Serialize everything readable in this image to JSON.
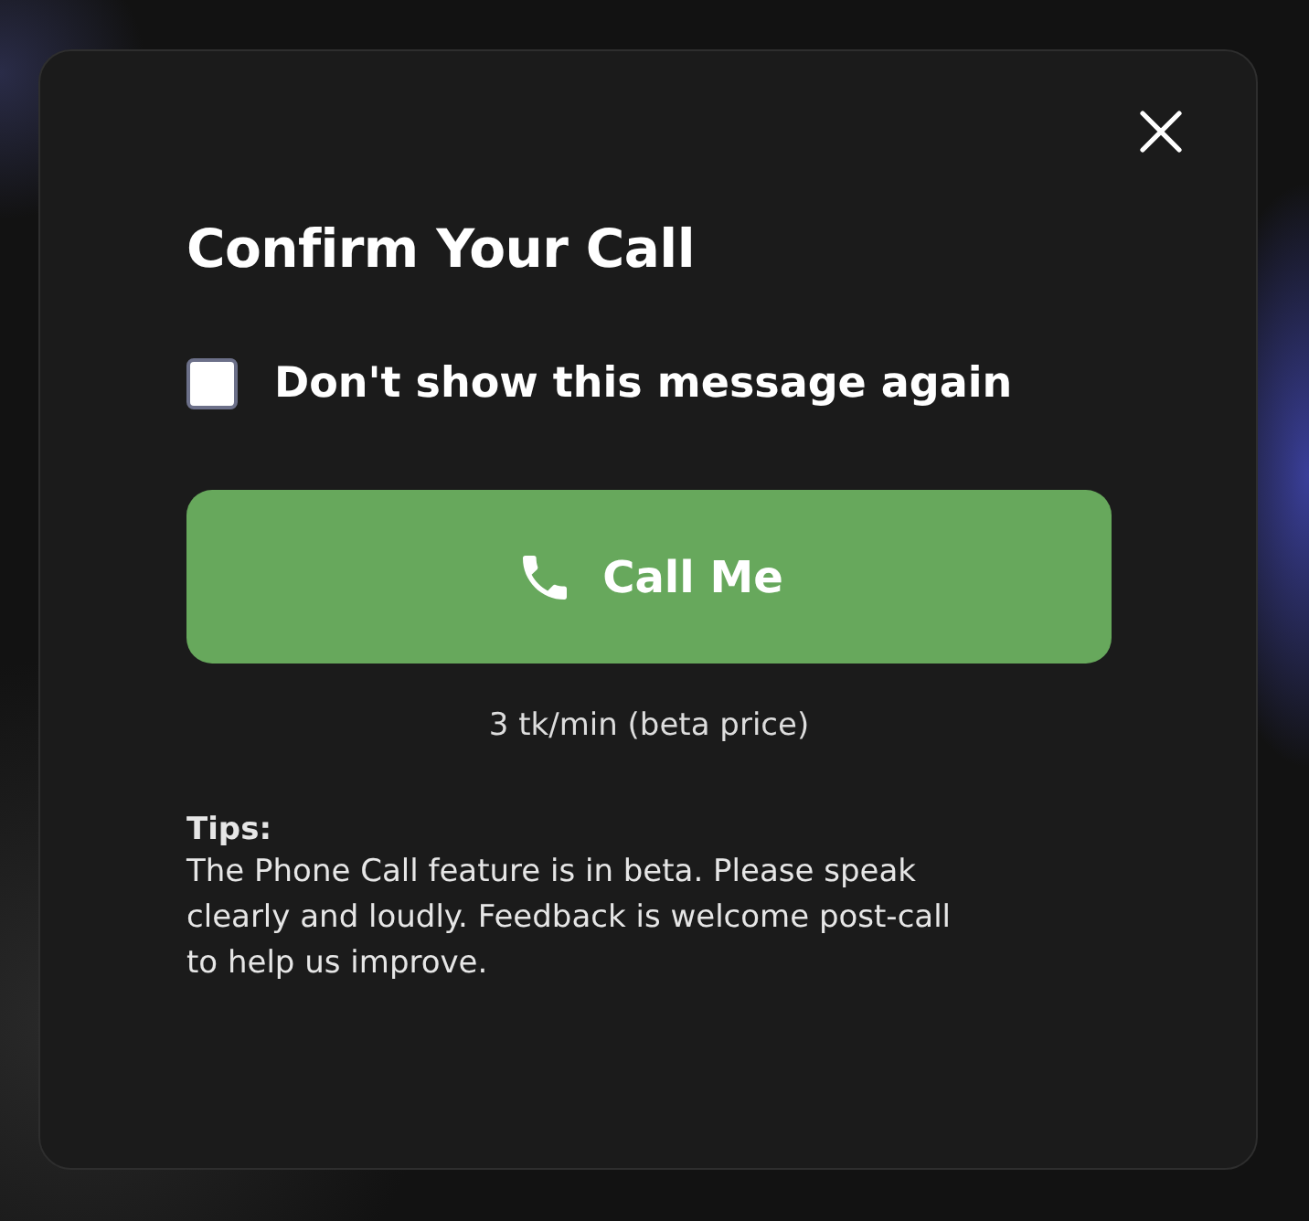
{
  "dialog": {
    "title": "Confirm Your Call",
    "checkbox": {
      "label": "Don't show this message again",
      "checked": false
    },
    "call_button": {
      "label": "Call Me"
    },
    "price": "3 tk/min (beta price)",
    "tips": {
      "heading": "Tips:",
      "text": "The Phone Call feature is in beta. Please speak clearly and loudly. Feedback is welcome post-call to help us improve."
    }
  }
}
